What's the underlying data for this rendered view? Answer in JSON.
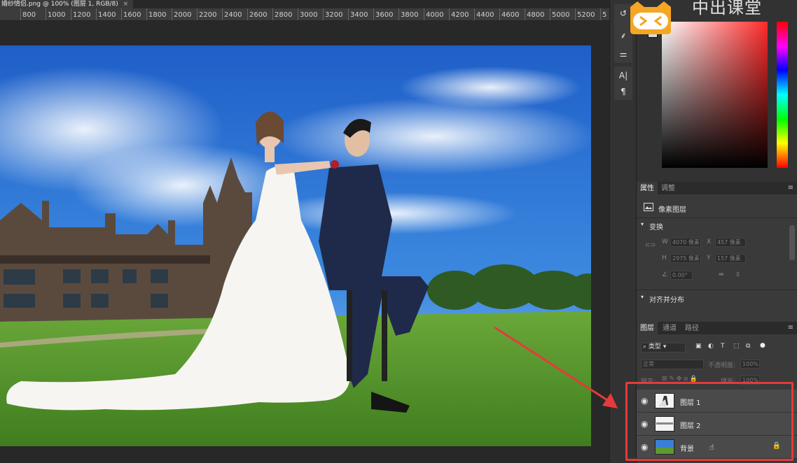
{
  "document": {
    "tab_title": "婚纱情侣.png @ 100% (图层 1, RGB/8)",
    "tab_close": "×"
  },
  "ruler": {
    "ticks": [
      "800",
      "1000",
      "1200",
      "1400",
      "1600",
      "1800",
      "2000",
      "2200",
      "2400",
      "2600",
      "2800",
      "3000",
      "3200",
      "3400",
      "3600",
      "3800",
      "4000",
      "4200",
      "4400",
      "4600",
      "4800",
      "5000",
      "5200",
      "5"
    ]
  },
  "watermark": {
    "text": "中出课堂"
  },
  "mini_tools": {
    "icons": [
      "history-icon",
      "brush-preset-icon",
      "adjust-sliders-icon",
      "character-icon",
      "paragraph-icon"
    ],
    "glyphs": [
      "↺",
      "⸙",
      "⚌",
      "A|",
      "¶"
    ]
  },
  "properties": {
    "tabs": [
      "属性",
      "调整"
    ],
    "menu": "≡",
    "layer_type": "像素图层",
    "transform_heading": "变换",
    "w_label": "W",
    "w_value": "4070 像素",
    "h_label": "H",
    "h_value": "2975 像素",
    "x_label": "X",
    "x_value": "457 像素",
    "y_label": "Y",
    "y_value": "157 像素",
    "angle_value": "0.00°",
    "align_heading": "对齐并分布"
  },
  "layers_panel": {
    "tabs": [
      "图层",
      "通道",
      "路径"
    ],
    "menu": "≡",
    "filter_label": "类型",
    "blend_mode": "正常",
    "opacity_label": "不透明度:",
    "opacity_value": "100%",
    "lock_label": "锁定:",
    "fill_label": "填充:",
    "fill_value": "100%",
    "layers": [
      {
        "name": "图层 1",
        "visible": true,
        "locked": false
      },
      {
        "name": "图层 2",
        "visible": true,
        "locked": false
      },
      {
        "name": "背景",
        "visible": true,
        "locked": true
      }
    ]
  },
  "colors": {
    "highlight": "#e63a3a",
    "accent_logo": "#f5a623"
  }
}
